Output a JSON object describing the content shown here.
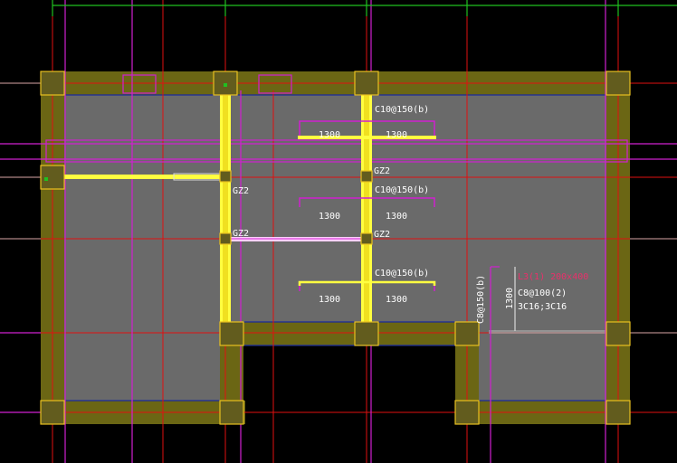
{
  "colors": {
    "background": "#000000",
    "wall": "#6b6614",
    "slab": "#6a6a6a",
    "column": "#625c1e",
    "column_outline": "#e8c020",
    "grid_red": "#e01010",
    "grid_magenta": "#d020d0",
    "grid_white": "#d8d8d8",
    "grid_green": "#20c020",
    "beam_yellow": "#ffff40",
    "text": "#ffffff",
    "text_red": "#e8306a",
    "edge_blue": "#1a2a9a"
  },
  "labels": {
    "rebar_top": "C10@150(b)",
    "rebar_mid": "C10@150(b)",
    "rebar_bot": "C10@150(b)",
    "span_1": "1300",
    "span_2": "1300",
    "span_3": "1300",
    "span_4": "1300",
    "span_5": "1300",
    "span_6": "1300",
    "gz_1": "GZ2",
    "gz_2": "GZ2",
    "gz_3": "GZ2",
    "gz_4": "GZ2",
    "side_rebar": "C8@150(b)",
    "side_span": "1300",
    "beam_name": "L3(1) 200x400",
    "beam_stirrup": "C8@100(2)",
    "beam_bars": "3C16;3C16"
  }
}
